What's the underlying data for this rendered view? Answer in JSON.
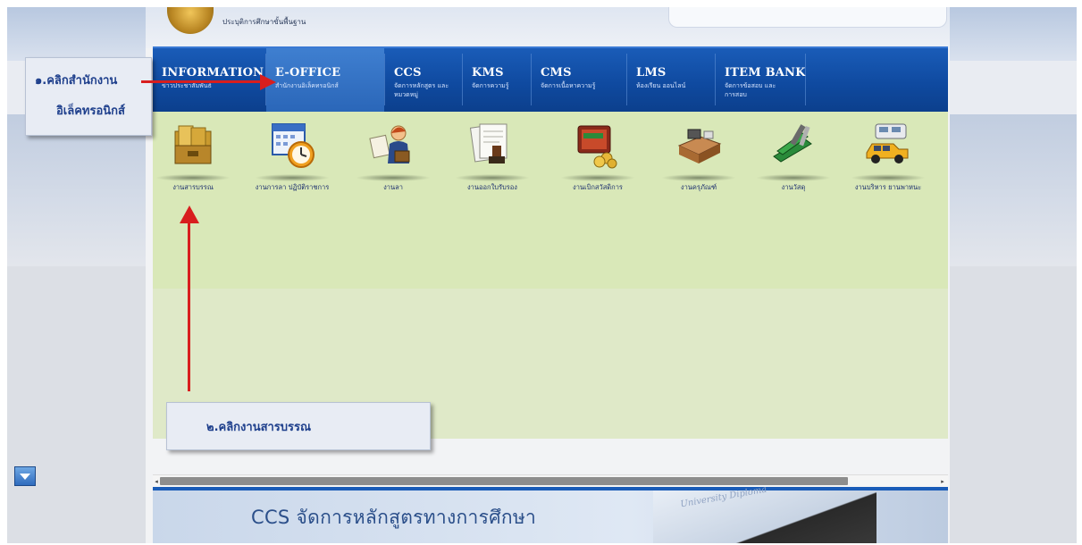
{
  "header": {
    "org_text": "ประบุติการศึกษาขั้นพื้นฐาน"
  },
  "nav": {
    "items": [
      {
        "title": "INFORMATION",
        "sub": "ข่าวประชาสัมพันธ์",
        "active": false
      },
      {
        "title": "E-OFFICE",
        "sub": "สำนักงานอิเล็คทรอนิกส์",
        "active": true
      },
      {
        "title": "CCS",
        "sub": "จัดการหลักสูตร และหมวดหมู่",
        "active": false
      },
      {
        "title": "KMS",
        "sub": "จัดการความรู้",
        "active": false
      },
      {
        "title": "CMS",
        "sub": "จัดการเนื้อหาความรู้",
        "active": false
      },
      {
        "title": "LMS",
        "sub": "ห้องเรียน ออนไลน์",
        "active": false
      },
      {
        "title": "ITEM BANK",
        "sub": "จัดการข้อสอบ และการสอบ",
        "active": false
      }
    ]
  },
  "icons": [
    {
      "label": "งานสารบรรณ",
      "icon": "folder-box-icon"
    },
    {
      "label": "งานการลา ปฏิบัติราชการ",
      "icon": "calendar-clock-icon"
    },
    {
      "label": "งานลา",
      "icon": "person-briefcase-icon"
    },
    {
      "label": "งานออกใบรับรอง",
      "icon": "certificate-stamp-icon"
    },
    {
      "label": "งานเบิกสวัสดิการ",
      "icon": "wallet-coins-icon"
    },
    {
      "label": "งานครุภัณฑ์",
      "icon": "desk-equipment-icon"
    },
    {
      "label": "งานวัสดุ",
      "icon": "stapler-supplies-icon"
    },
    {
      "label": "งานบริหาร ยานพาหนะ",
      "icon": "vehicles-icon"
    }
  ],
  "callouts": {
    "step1_line1": "๑.คลิกสำนักงาน",
    "step1_line2": "อิเล็คทรอนิกส์",
    "step2": "๒.คลิกงานสารบรรณ"
  },
  "banner": {
    "text": "CCS จัดการหลักสูตรทางการศึกษา",
    "diploma_text": "University Diploma"
  },
  "colors": {
    "nav_blue": "#1a5cb8",
    "content_green": "#d9e8b8",
    "arrow_red": "#d81e1e",
    "callout_text": "#1e3f8c"
  }
}
